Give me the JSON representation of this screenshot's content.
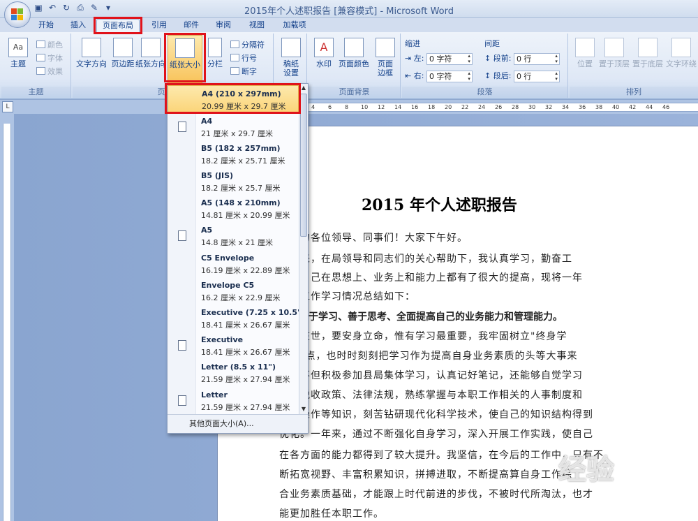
{
  "title_bar": {
    "title": "2015年个人述职报告 [兼容模式] - Microsoft Word",
    "qat_extra": "▾"
  },
  "tabs": [
    {
      "label": "开始"
    },
    {
      "label": "插入"
    },
    {
      "label": "页面布局"
    },
    {
      "label": "引用"
    },
    {
      "label": "邮件"
    },
    {
      "label": "审阅"
    },
    {
      "label": "视图"
    },
    {
      "label": "加载项"
    }
  ],
  "ribbon": {
    "theme": {
      "btn": "主题",
      "color": "颜色",
      "font": "字体",
      "effect": "效果",
      "group": "主题"
    },
    "page_setup": {
      "text_dir": "文字方向",
      "margins": "页边距",
      "orientation": "纸张方向",
      "size": "纸张大小",
      "columns": "分栏",
      "breaks": "分隔符",
      "line_num": "行号",
      "hyphen": "断字",
      "group": "页面设置"
    },
    "manuscript": {
      "btn1": "稿纸",
      "btn2": "设置"
    },
    "background": {
      "watermark": "水印",
      "page_color": "页面颜色",
      "border1": "页面",
      "border2": "边框",
      "group": "页面背景"
    },
    "paragraph": {
      "indent": "缩进",
      "spacing": "间距",
      "left": "左:",
      "right": "右:",
      "before": "段前:",
      "after": "段后:",
      "left_val": "0 字符",
      "right_val": "0 字符",
      "before_val": "0 行",
      "after_val": "0 行",
      "group": "段落"
    },
    "arrange": {
      "position": "位置",
      "front": "置于顶层",
      "back": "置于底层",
      "wrap": "文字环绕",
      "group": "排列"
    }
  },
  "ruler": {
    "ticks": [
      "4",
      "6",
      "8",
      "10",
      "12",
      "14",
      "16",
      "18",
      "20",
      "22",
      "24",
      "26",
      "28",
      "30",
      "32",
      "34",
      "36",
      "38",
      "40",
      "42",
      "44",
      "46"
    ]
  },
  "dropdown": {
    "items": [
      {
        "name": "A4 (210 x 297mm)",
        "size": "20.99 厘米 x 29.7 厘米",
        "selected": true
      },
      {
        "name": "A4",
        "size": "21 厘米 x 29.7 厘米"
      },
      {
        "name": "B5 (182 x 257mm)",
        "size": "18.2 厘米 x 25.71 厘米"
      },
      {
        "name": "B5 (JIS)",
        "size": "18.2 厘米 x 25.7 厘米"
      },
      {
        "name": "A5 (148 x 210mm)",
        "size": "14.81 厘米 x 20.99 厘米"
      },
      {
        "name": "A5",
        "size": "14.8 厘米 x 21 厘米"
      },
      {
        "name": "C5 Envelope",
        "size": "16.19 厘米 x 22.89 厘米"
      },
      {
        "name": "Envelope C5",
        "size": "16.2 厘米 x 22.9 厘米"
      },
      {
        "name": "Executive (7.25 x 10.5\")",
        "size": "18.41 厘米 x 26.67 厘米"
      },
      {
        "name": "Executive",
        "size": "18.41 厘米 x 26.67 厘米"
      },
      {
        "name": "Letter (8.5 x 11\")",
        "size": "21.59 厘米 x 27.94 厘米"
      },
      {
        "name": "Letter",
        "size": "21.59 厘米 x 27.94 厘米"
      }
    ],
    "footer": "其他页面大小(A)..."
  },
  "document": {
    "title": "2015 年个人述职报告",
    "lines": [
      "尊敬的各位领导、同事们！大家下午好。",
      "一年来，在局领导和同志们的关心帮助下，我认真学习，勤奋工",
      "作，自己在思想上、业务上和能力上都有了很大的提高，现将一年",
      "来的工作学习情况总结如下：",
      "一、勤于学习、善于思考、全面提高自己的业务能力和管理能力。",
      "人生在世，要安身立命，惟有学习最重要，我牢固树立\"终身学",
      "习\"观点，也时时刻刻把学习作为提高自身业务素质的头等大事来",
      "抓，不但积极参加县局集体学习，认真记好笔记，还能够自觉学习",
      "有关税收政策、法律法规，熟练掌握与本职工作相关的人事制度和",
      "电脑操作等知识，刻苦钻研现代化科学技术，使自己的知识结构得到",
      "优化。一年来，通过不断强化自身学习，深入开展工作实践，使自己",
      "在各方面的能力都得到了较大提升。我坚信，在今后的工作中，只有不",
      "断拓宽视野、丰富积累知识，拼搏进取，不断提高算自身工作综",
      "合业务素质基础，才能跟上时代前进的步伐，不被时代所淘汰，也才",
      "能更加胜任本职工作。"
    ]
  },
  "watermark": "经验"
}
